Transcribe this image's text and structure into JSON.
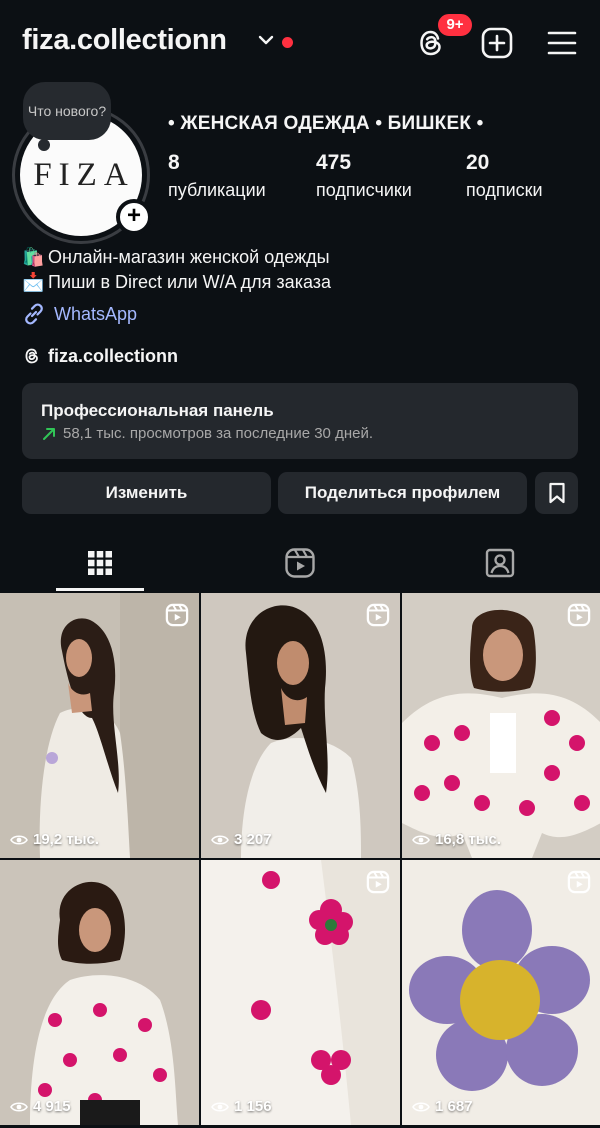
{
  "header": {
    "username": "fiza.collectionn",
    "badge": "9+"
  },
  "profile": {
    "note": "Что нового?",
    "avatar_text": "FIZA",
    "category": "• ЖЕНСКАЯ ОДЕЖДА • БИШКЕК •",
    "stats": [
      {
        "value": "8",
        "label": "публикации"
      },
      {
        "value": "475",
        "label": "подписчики"
      },
      {
        "value": "20",
        "label": "подписки"
      }
    ],
    "bio": [
      {
        "emoji": "🛍️",
        "text": "Онлайн-магазин женской одежды"
      },
      {
        "emoji": "📩",
        "text": "Пиши в Direct или W/A для заказа"
      }
    ],
    "link": "WhatsApp",
    "threads_handle": "fiza.collectionn"
  },
  "dashboard": {
    "title": "Профессиональная панель",
    "subtitle": "58,1 тыс. просмотров за последние 30 дней."
  },
  "buttons": {
    "edit": "Изменить",
    "share": "Поделиться профилем"
  },
  "tabs": [
    "grid-icon",
    "reels-icon",
    "tagged-icon"
  ],
  "posts": [
    {
      "views": "19,2 тыс."
    },
    {
      "views": "3 207"
    },
    {
      "views": "16,8 тыс."
    },
    {
      "views": "4 915"
    },
    {
      "views": "1 156"
    },
    {
      "views": "1 687"
    }
  ],
  "colors": {
    "background": "#0c1014",
    "surface": "#24282d",
    "accent_red": "#ff3040",
    "link": "#a4b8ff",
    "trend_green": "#31c557"
  }
}
